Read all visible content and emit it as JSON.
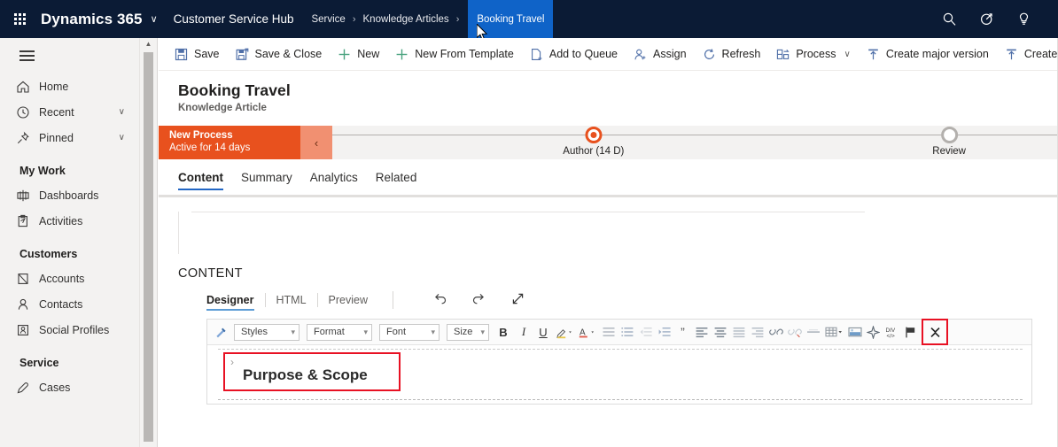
{
  "topbar": {
    "waffle_title": "app-launcher",
    "brand": "Dynamics 365",
    "brand_chevron": "∨",
    "app_name": "Customer Service Hub",
    "breadcrumbs": [
      {
        "label": "Service",
        "active": false
      },
      {
        "label": "Knowledge Articles",
        "active": false
      },
      {
        "label": "Booking Travel",
        "active": true
      }
    ],
    "crumb_separator": "›",
    "icons": [
      {
        "name": "search-icon",
        "title": "Search"
      },
      {
        "name": "filter-icon",
        "title": "Filter"
      },
      {
        "name": "lightbulb-icon",
        "title": "Assistant"
      }
    ]
  },
  "sidebar": {
    "hamburger_label": "Site Map",
    "items": [
      {
        "label": "Home",
        "icon": "home-icon",
        "chevron": ""
      },
      {
        "label": "Recent",
        "icon": "clock-icon",
        "chevron": "∨"
      },
      {
        "label": "Pinned",
        "icon": "pin-icon",
        "chevron": "∨"
      }
    ],
    "groups": [
      {
        "title": "My Work",
        "items": [
          {
            "label": "Dashboards",
            "icon": "dashboard-icon"
          },
          {
            "label": "Activities",
            "icon": "activities-icon"
          }
        ]
      },
      {
        "title": "Customers",
        "items": [
          {
            "label": "Accounts",
            "icon": "account-icon"
          },
          {
            "label": "Contacts",
            "icon": "contact-icon"
          },
          {
            "label": "Social Profiles",
            "icon": "social-profile-icon"
          }
        ]
      },
      {
        "title": "Service",
        "items": [
          {
            "label": "Cases",
            "icon": "case-icon"
          }
        ]
      }
    ]
  },
  "commandbar": {
    "items": [
      {
        "label": "Save",
        "icon": "save-icon",
        "chevron": ""
      },
      {
        "label": "Save & Close",
        "icon": "save-close-icon",
        "chevron": ""
      },
      {
        "label": "New",
        "icon": "plus-icon",
        "chevron": ""
      },
      {
        "label": "New From Template",
        "icon": "plus-icon",
        "chevron": ""
      },
      {
        "label": "Add to Queue",
        "icon": "add-queue-icon",
        "chevron": ""
      },
      {
        "label": "Assign",
        "icon": "assign-icon",
        "chevron": ""
      },
      {
        "label": "Refresh",
        "icon": "refresh-icon",
        "chevron": ""
      },
      {
        "label": "Process",
        "icon": "process-icon",
        "chevron": "∨"
      },
      {
        "label": "Create major version",
        "icon": "upload-icon",
        "chevron": ""
      },
      {
        "label": "Create minor v",
        "icon": "upload-icon",
        "chevron": ""
      }
    ]
  },
  "record": {
    "title": "Booking Travel",
    "subtitle": "Knowledge Article"
  },
  "process": {
    "name": "New Process",
    "status": "Active for 14 days",
    "collapse_glyph": "‹",
    "stages": [
      {
        "label": "Author",
        "days": "(14 D)",
        "state": "active",
        "pos_pct": 36
      },
      {
        "label": "Review",
        "days": "",
        "state": "inactive",
        "pos_pct": 85
      }
    ]
  },
  "tabs": [
    {
      "label": "Content",
      "active": true
    },
    {
      "label": "Summary",
      "active": false
    },
    {
      "label": "Analytics",
      "active": false
    },
    {
      "label": "Related",
      "active": false
    }
  ],
  "content_section": {
    "heading": "CONTENT",
    "modes": [
      {
        "label": "Designer",
        "active": true
      },
      {
        "label": "HTML",
        "active": false
      },
      {
        "label": "Preview",
        "active": false
      }
    ],
    "mode_buttons": [
      {
        "name": "undo-icon",
        "title": "Undo"
      },
      {
        "name": "redo-icon",
        "title": "Redo"
      },
      {
        "name": "expand-icon",
        "title": "Expand"
      }
    ]
  },
  "rte_toolbar": {
    "format_painter": {
      "name": "format-painter-icon",
      "title": "Format Painter"
    },
    "selects": [
      {
        "name": "styles-select",
        "label": "Styles",
        "caret": "▾",
        "width_class": "w-styles"
      },
      {
        "name": "format-select",
        "label": "Format",
        "caret": "▾",
        "width_class": "w-format"
      },
      {
        "name": "font-select",
        "label": "Font",
        "caret": "▾",
        "width_class": "w-font"
      },
      {
        "name": "size-select",
        "label": "Size",
        "caret": "▾",
        "width_class": "w-size"
      }
    ],
    "buttons": [
      {
        "name": "bold-button",
        "glyph": "B",
        "kind": "text",
        "style": "bold",
        "highlight": false
      },
      {
        "name": "italic-button",
        "glyph": "I",
        "kind": "text",
        "style": "italic",
        "highlight": false
      },
      {
        "name": "underline-button",
        "glyph": "U",
        "kind": "text",
        "style": "underline",
        "highlight": false
      },
      {
        "name": "highlight-color-icon",
        "glyph": "",
        "kind": "svg",
        "svg": "marker",
        "caret": true,
        "highlight": false
      },
      {
        "name": "font-color-icon",
        "glyph": "A",
        "kind": "svg",
        "svg": "fontcolor",
        "caret": true,
        "highlight": false
      },
      {
        "name": "bulleted-list-icon",
        "glyph": "",
        "kind": "svg",
        "svg": "ul",
        "highlight": false
      },
      {
        "name": "numbered-list-icon",
        "glyph": "",
        "kind": "svg",
        "svg": "ol",
        "highlight": false
      },
      {
        "name": "decrease-indent-icon",
        "glyph": "",
        "kind": "svg",
        "svg": "outdent",
        "highlight": false
      },
      {
        "name": "increase-indent-icon",
        "glyph": "",
        "kind": "svg",
        "svg": "indent",
        "highlight": false
      },
      {
        "name": "blockquote-icon",
        "glyph": "”",
        "kind": "text",
        "style": "quote",
        "highlight": false
      },
      {
        "name": "align-left-icon",
        "glyph": "",
        "kind": "svg",
        "svg": "alignleft",
        "highlight": false
      },
      {
        "name": "align-center-icon",
        "glyph": "",
        "kind": "svg",
        "svg": "aligncenter",
        "highlight": false
      },
      {
        "name": "align-justify-icon",
        "glyph": "",
        "kind": "svg",
        "svg": "alignjustify",
        "highlight": false
      },
      {
        "name": "align-right-icon",
        "glyph": "",
        "kind": "svg",
        "svg": "alignright",
        "highlight": false
      },
      {
        "name": "insert-link-icon",
        "glyph": "",
        "kind": "svg",
        "svg": "link",
        "highlight": false
      },
      {
        "name": "remove-link-icon",
        "glyph": "",
        "kind": "svg",
        "svg": "unlink",
        "highlight": false
      },
      {
        "name": "horizontal-rule-icon",
        "glyph": "",
        "kind": "svg",
        "svg": "hr",
        "highlight": false
      },
      {
        "name": "insert-table-icon",
        "glyph": "",
        "kind": "svg",
        "svg": "table",
        "caret": true,
        "highlight": false
      },
      {
        "name": "insert-image-icon",
        "glyph": "",
        "kind": "svg",
        "svg": "image",
        "highlight": false
      },
      {
        "name": "ai-sparkle-icon",
        "glyph": "",
        "kind": "svg",
        "svg": "sparkle",
        "highlight": false
      },
      {
        "name": "source-code-icon",
        "glyph": "",
        "kind": "svg",
        "svg": "divcode",
        "highlight": false
      },
      {
        "name": "flag-icon",
        "glyph": "",
        "kind": "svg",
        "svg": "flag",
        "highlight": false
      },
      {
        "name": "collapse-toolbar-button",
        "glyph": "",
        "kind": "svg",
        "svg": "collapsex",
        "highlight": true
      }
    ]
  },
  "editor_body": {
    "chevron": "›",
    "heading": "Purpose & Scope",
    "selection_highlighted": true
  },
  "colors": {
    "navbar": "#0b1b35",
    "crumb_active": "#0f63c8",
    "process_orange": "#e8511e",
    "process_collapse": "#f19071",
    "tab_underline": "#2266c4",
    "highlight_red": "#e81123",
    "sidebar_bg": "#f3f2f1"
  }
}
